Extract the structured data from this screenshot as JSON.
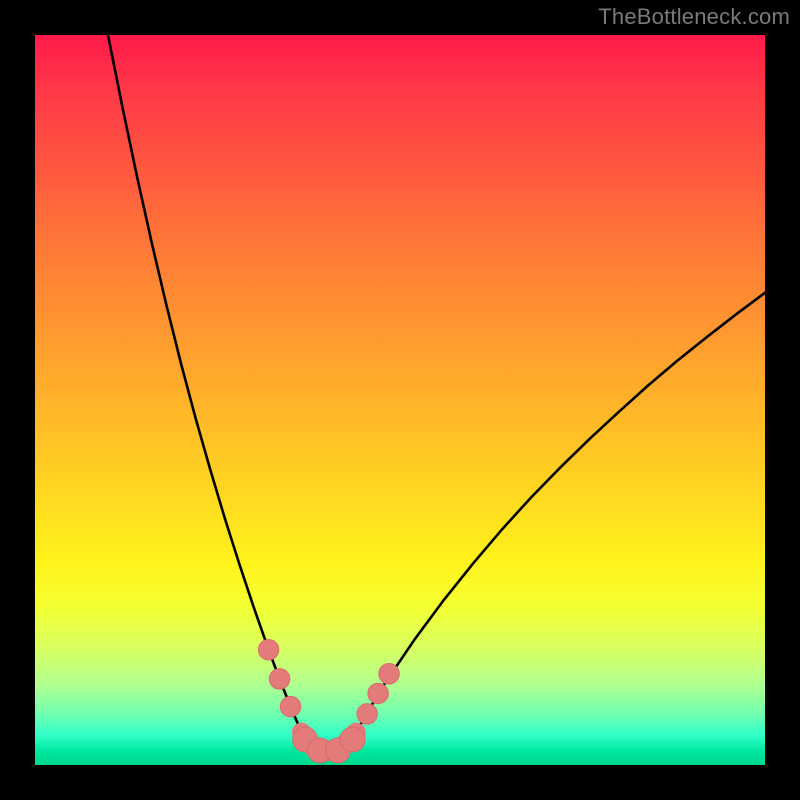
{
  "watermark": "TheBottleneck.com",
  "colors": {
    "frame": "#000000",
    "curve": "#000000",
    "marker_fill": "#e47b7b",
    "marker_stroke": "#d86a6a"
  },
  "chart_data": {
    "type": "line",
    "title": "",
    "xlabel": "",
    "ylabel": "",
    "xlim": [
      0,
      100
    ],
    "ylim": [
      0,
      100
    ],
    "grid": false,
    "series": [
      {
        "name": "left-curve",
        "x": [
          10,
          12,
          14,
          16,
          18,
          20,
          22,
          24,
          26,
          28,
          30,
          32,
          33.5,
          35,
          36.5
        ],
        "values": [
          100,
          90,
          80.5,
          71.5,
          63,
          55,
          47.5,
          40.5,
          33.8,
          27.5,
          21.5,
          15.8,
          11.8,
          8.0,
          4.5
        ]
      },
      {
        "name": "right-curve",
        "x": [
          44,
          46,
          48,
          52,
          56,
          60,
          64,
          68,
          72,
          76,
          80,
          84,
          88,
          92,
          96,
          100
        ],
        "values": [
          4.5,
          8.0,
          11.3,
          17.2,
          22.6,
          27.6,
          32.3,
          36.7,
          40.8,
          44.7,
          48.4,
          52.0,
          55.4,
          58.6,
          61.7,
          64.7
        ]
      },
      {
        "name": "bottom-band",
        "x": [
          36.5,
          38,
          40,
          42,
          44
        ],
        "values": [
          4.5,
          2.5,
          1.8,
          2.5,
          4.5
        ]
      }
    ],
    "markers": [
      {
        "x": 32.0,
        "y": 15.8,
        "r": 1.4
      },
      {
        "x": 33.5,
        "y": 11.8,
        "r": 1.4
      },
      {
        "x": 35.0,
        "y": 8.0,
        "r": 1.4
      },
      {
        "x": 37.0,
        "y": 3.5,
        "r": 1.7
      },
      {
        "x": 39.0,
        "y": 2.0,
        "r": 1.7
      },
      {
        "x": 41.5,
        "y": 2.0,
        "r": 1.7
      },
      {
        "x": 43.5,
        "y": 3.5,
        "r": 1.7
      },
      {
        "x": 45.5,
        "y": 7.0,
        "r": 1.4
      },
      {
        "x": 47.0,
        "y": 9.8,
        "r": 1.4
      },
      {
        "x": 48.5,
        "y": 12.5,
        "r": 1.4
      }
    ]
  }
}
